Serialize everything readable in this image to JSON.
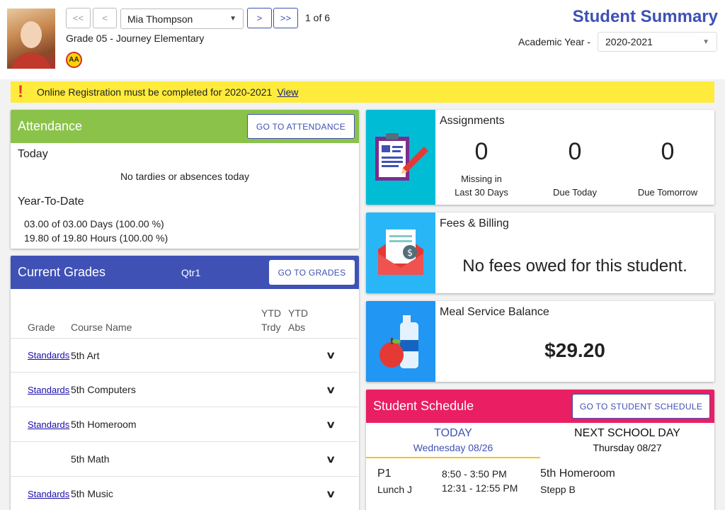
{
  "header": {
    "title": "Student Summary",
    "nav": {
      "first": "<<",
      "prev": "<",
      "next": ">",
      "last": ">>"
    },
    "student_name": "Mia Thompson",
    "position": "1 of 6",
    "grade_school": "Grade 05 - Journey Elementary",
    "badge": "AA",
    "academic_year_label": "Academic Year -",
    "academic_year": "2020-2021"
  },
  "alert": {
    "icon": "!",
    "message": "Online Registration must be completed for 2020-2021",
    "link": "View"
  },
  "attendance": {
    "title": "Attendance",
    "button": "GO TO ATTENDANCE",
    "today_label": "Today",
    "today_text": "No tardies or absences today",
    "ytd_label": "Year-To-Date",
    "ytd_days": "03.00 of 03.00 Days (100.00 %)",
    "ytd_hours": "19.80 of 19.80 Hours (100.00 %)"
  },
  "grades": {
    "title": "Current Grades",
    "term": "Qtr1",
    "button": "GO TO GRADES",
    "col_grade": "Grade",
    "col_course": "Course Name",
    "col_trdy_1": "YTD",
    "col_trdy_2": "Trdy",
    "col_abs_1": "YTD",
    "col_abs_2": "Abs",
    "rows": [
      {
        "link": "Standards",
        "course": "5th Art"
      },
      {
        "link": "Standards",
        "course": "5th Computers"
      },
      {
        "link": "Standards",
        "course": "5th Homeroom"
      },
      {
        "link": "",
        "course": "5th Math"
      },
      {
        "link": "Standards",
        "course": "5th Music"
      }
    ]
  },
  "assignments": {
    "title": "Assignments",
    "missing": {
      "value": "0",
      "label1": "Missing in",
      "label2": "Last 30 Days"
    },
    "due_today": {
      "value": "0",
      "label": "Due Today"
    },
    "due_tomorrow": {
      "value": "0",
      "label": "Due Tomorrow"
    }
  },
  "fees": {
    "title": "Fees & Billing",
    "message": "No fees owed for this student."
  },
  "meal": {
    "title": "Meal Service Balance",
    "balance": "$29.20"
  },
  "schedule": {
    "title": "Student Schedule",
    "button": "GO TO STUDENT SCHEDULE",
    "today_label": "TODAY",
    "today_date": "Wednesday 08/26",
    "next_label": "NEXT SCHOOL DAY",
    "next_date": "Thursday 08/27",
    "period": "P1",
    "lunch": "Lunch J",
    "time1": "8:50 - 3:50 PM",
    "time2": "12:31 - 12:55 PM",
    "course": "5th Homeroom",
    "teacher": "Stepp B"
  },
  "colors": {
    "attendance": "#8bc34a",
    "grades": "#3f51b5",
    "assignments_icon": "#00bcd4",
    "fees_icon": "#29b6f6",
    "meal_icon": "#2196f3",
    "schedule": "#e91e63",
    "alert": "#ffeb3b",
    "title": "#3f51b5"
  }
}
